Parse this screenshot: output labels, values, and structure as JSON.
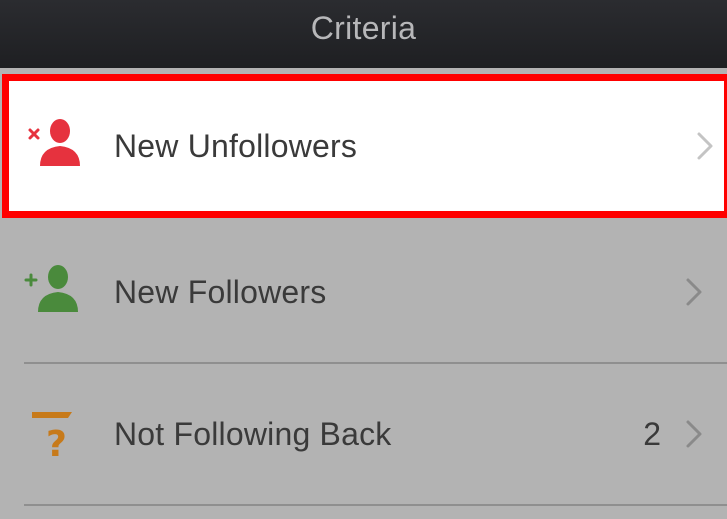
{
  "navbar": {
    "title": "Criteria"
  },
  "rows": [
    {
      "label": "New Unfollowers",
      "icon": "remove-user-icon",
      "count": ""
    },
    {
      "label": "New Followers",
      "icon": "add-user-icon",
      "count": ""
    },
    {
      "label": "Not Following Back",
      "icon": "question-user-icon",
      "count": "2"
    }
  ],
  "colors": {
    "highlight": "#ff0000",
    "unfollow_icon": "#e6323e",
    "follow_icon": "#4a8a3c",
    "question_icon": "#c77a1a"
  }
}
